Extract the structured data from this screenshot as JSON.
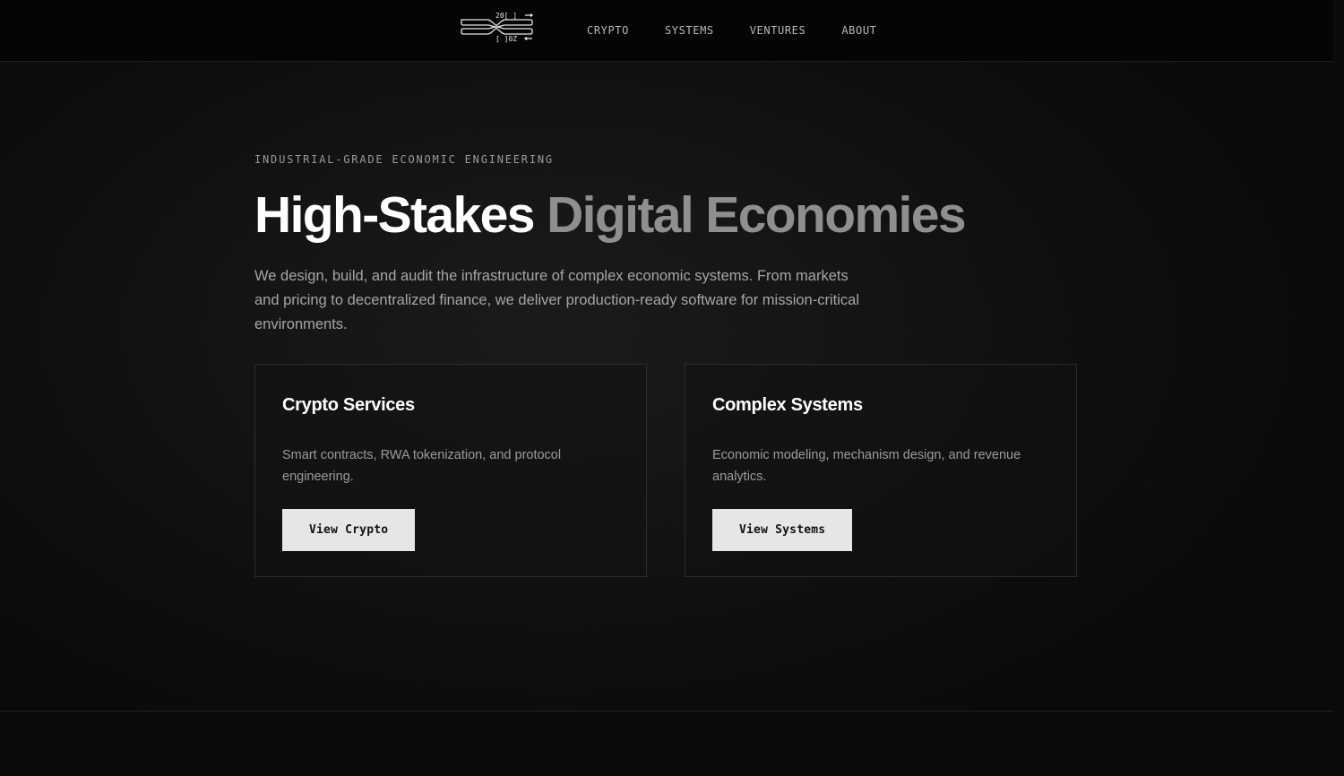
{
  "brand": {
    "logo_text_top": "20[ ]",
    "logo_text_bottom": "[ ]0Z",
    "logo_stroke_color": "#e8e8e8"
  },
  "nav": {
    "items": [
      {
        "label": "CRYPTO"
      },
      {
        "label": "SYSTEMS"
      },
      {
        "label": "VENTURES"
      },
      {
        "label": "ABOUT"
      }
    ]
  },
  "hero": {
    "eyebrow": "INDUSTRIAL-GRADE ECONOMIC ENGINEERING",
    "headline_strong": "High-Stakes",
    "headline_muted": "Digital Economies",
    "lede": "We design, build, and audit the infrastructure of complex economic systems. From markets and pricing to decentralized finance, we deliver production-ready software for mission-critical environments."
  },
  "cards": [
    {
      "title": "Crypto Services",
      "description": "Smart contracts, RWA tokenization, and protocol engineering.",
      "button_label": "View Crypto"
    },
    {
      "title": "Complex Systems",
      "description": "Economic modeling, mechanism design, and revenue analytics.",
      "button_label": "View Systems"
    }
  ],
  "colors": {
    "background": "#0a0a0a",
    "headline_strong": "#ffffff",
    "headline_muted": "#8f8f8f",
    "button_bg": "#e6e6e6",
    "card_border": "#2c2c2c"
  }
}
